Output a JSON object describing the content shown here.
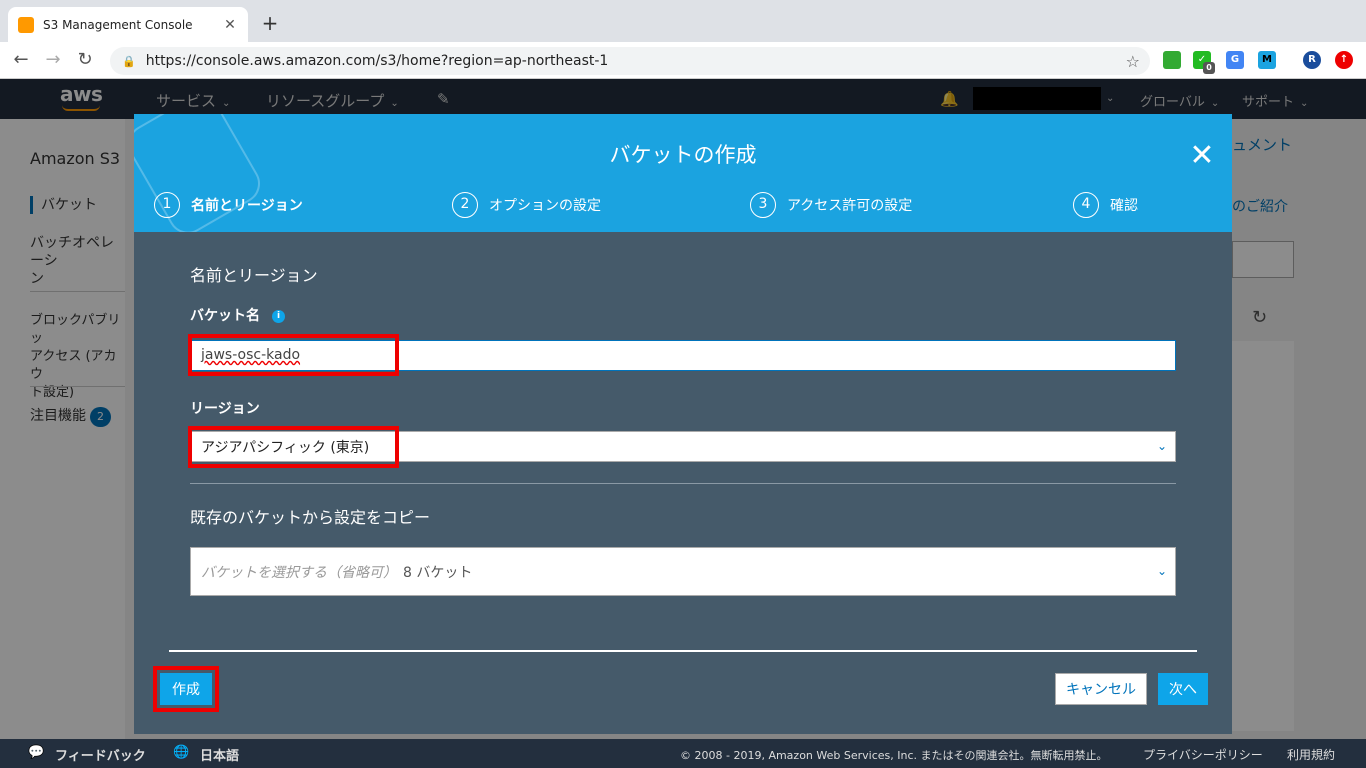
{
  "browser": {
    "tab_title": "S3 Management Console",
    "tab_close": "✕",
    "new_tab": "+",
    "url": "https://console.aws.amazon.com/s3/home?region=ap-northeast-1",
    "ext_badge": "0",
    "profile": "R"
  },
  "awsnav": {
    "logo": "aws",
    "services": "サービス",
    "resource_groups": "リソースグループ",
    "region": "グローバル",
    "support": "サポート"
  },
  "sidebar": {
    "title": "Amazon S3",
    "items": [
      "バケット",
      "バッチオペレーシ\nン",
      "ブロックパブリッ\nアクセス (アカウ\nト設定)",
      "注目機能"
    ],
    "badge": "2"
  },
  "background": {
    "docs_link": "ュメント",
    "intro_link": "のご紹介"
  },
  "modal": {
    "title": "バケットの作成",
    "close": "✕",
    "steps": [
      {
        "num": "1",
        "label": "名前とリージョン"
      },
      {
        "num": "2",
        "label": "オプションの設定"
      },
      {
        "num": "3",
        "label": "アクセス許可の設定"
      },
      {
        "num": "4",
        "label": "確認"
      }
    ],
    "section_title": "名前とリージョン",
    "bucket_name_label": "バケット名",
    "bucket_name_value": "jaws-osc-kado",
    "region_label": "リージョン",
    "region_value": "アジアパシフィック (東京)",
    "copy_title": "既存のバケットから設定をコピー",
    "copy_placeholder": "バケットを選択する（省略可）",
    "copy_count": "8 バケット",
    "create_button": "作成",
    "cancel_button": "キャンセル",
    "next_button": "次へ"
  },
  "footer": {
    "feedback": "フィードバック",
    "language": "日本語",
    "copyright": "© 2008 - 2019, Amazon Web Services, Inc. またはその関連会社。無断転用禁止。",
    "privacy": "プライバシーポリシー",
    "terms": "利用規約"
  },
  "colors": {
    "aws_nav": "#232f3e",
    "modal_header": "#1ba3e0",
    "modal_body": "#455a6a",
    "highlight": "#e00000"
  }
}
